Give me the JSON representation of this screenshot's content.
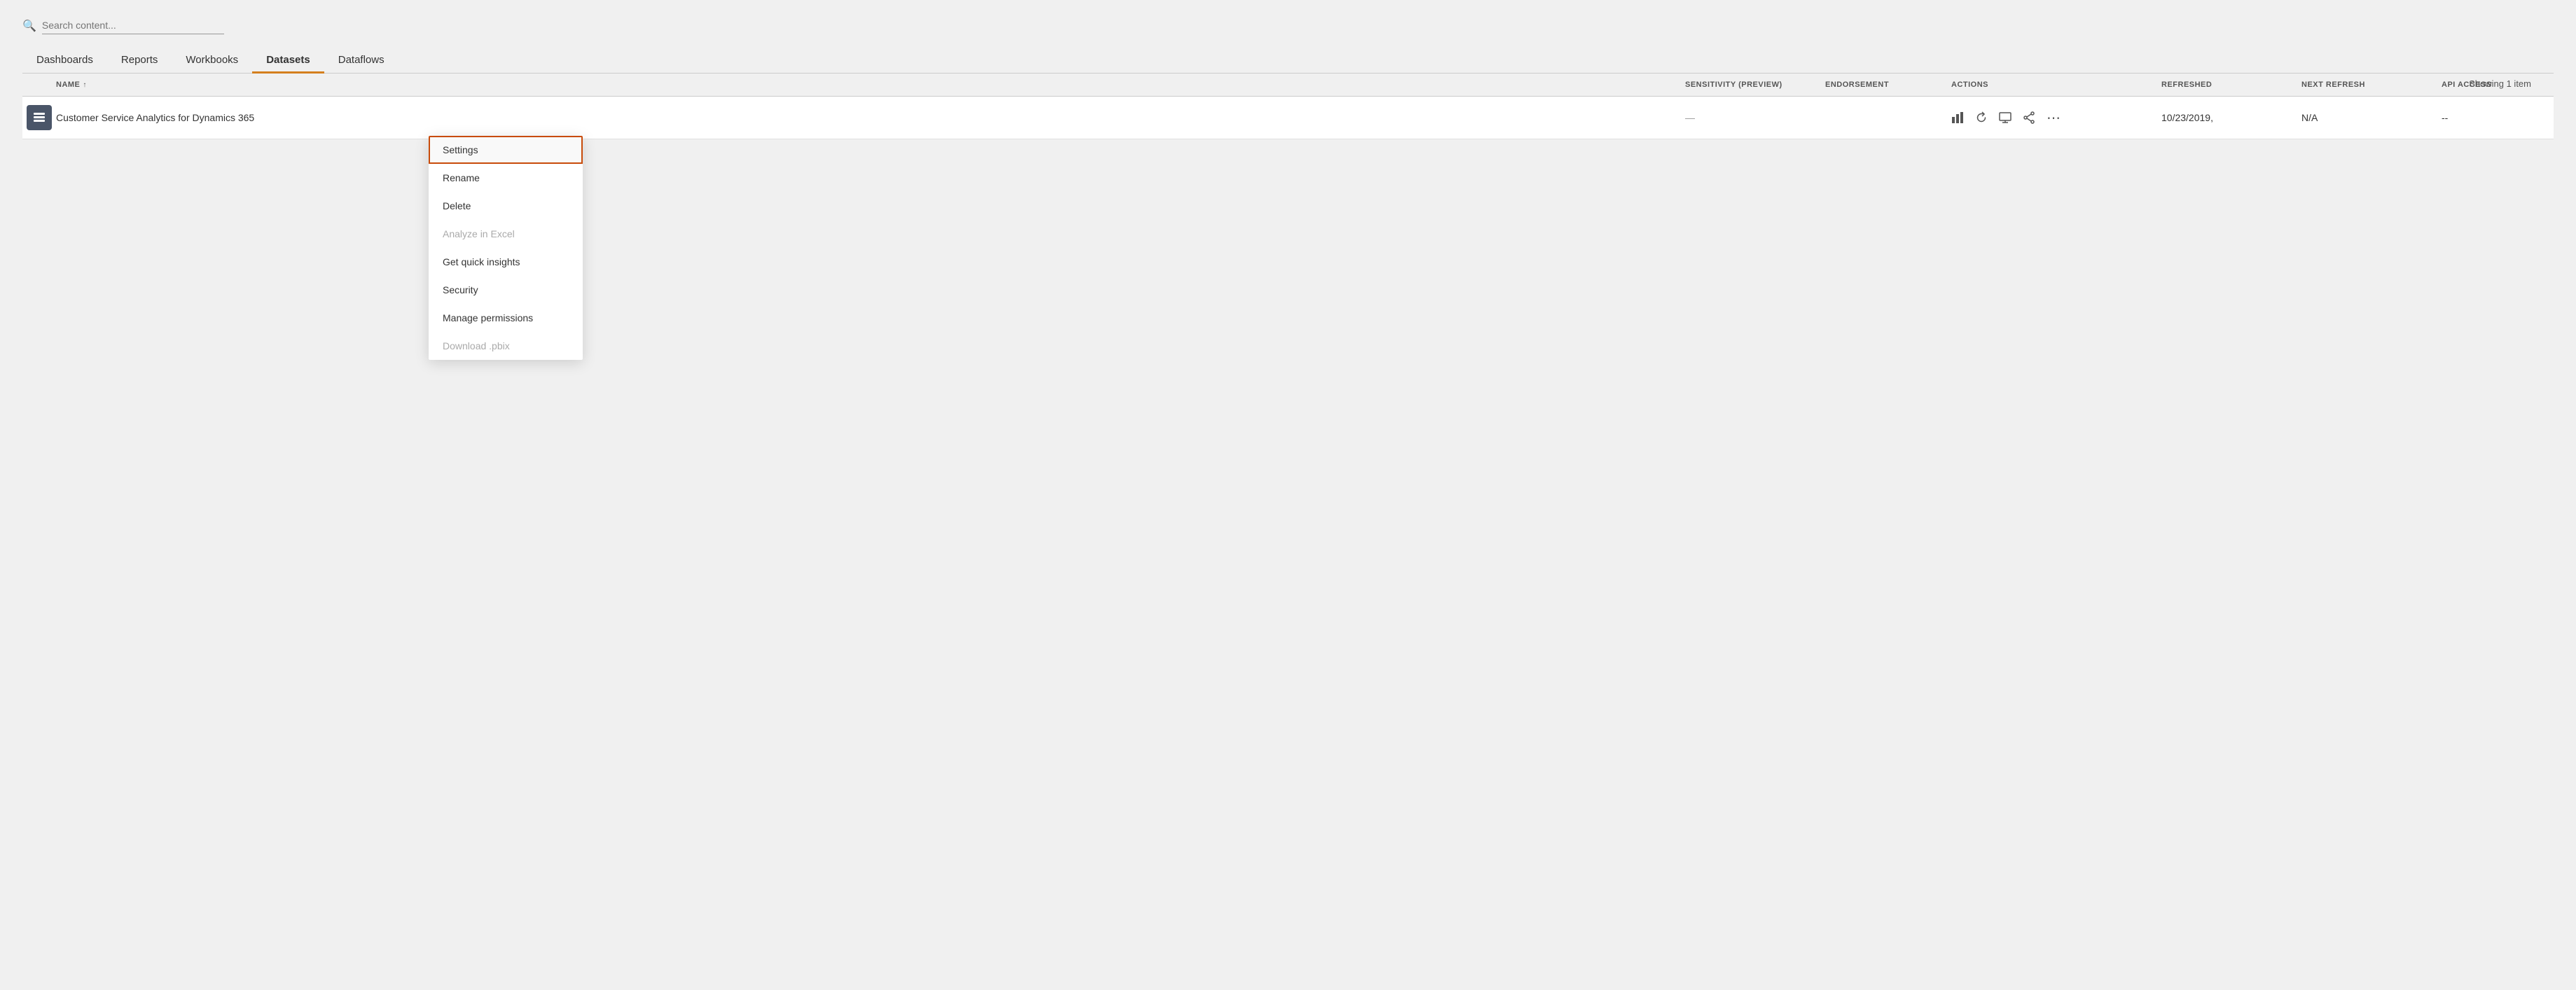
{
  "search": {
    "placeholder": "Search content..."
  },
  "showing": "Showing 1 item",
  "tabs": [
    {
      "id": "dashboards",
      "label": "Dashboards",
      "active": false
    },
    {
      "id": "reports",
      "label": "Reports",
      "active": false
    },
    {
      "id": "workbooks",
      "label": "Workbooks",
      "active": false
    },
    {
      "id": "datasets",
      "label": "Datasets",
      "active": true
    },
    {
      "id": "dataflows",
      "label": "Dataflows",
      "active": false
    }
  ],
  "table": {
    "headers": [
      {
        "id": "icon",
        "label": ""
      },
      {
        "id": "name",
        "label": "NAME",
        "sortable": true,
        "sort": "asc"
      },
      {
        "id": "sensitivity",
        "label": "SENSITIVITY (preview)"
      },
      {
        "id": "endorsement",
        "label": "ENDORSEMENT"
      },
      {
        "id": "actions",
        "label": "ACTIONS"
      },
      {
        "id": "refreshed",
        "label": "REFRESHED"
      },
      {
        "id": "next_refresh",
        "label": "NEXT REFRESH"
      },
      {
        "id": "api_access",
        "label": "API ACCESS"
      }
    ],
    "rows": [
      {
        "name": "Customer Service Analytics for Dynamics 365",
        "sensitivity": "—",
        "endorsement": "",
        "actions": [
          "chart",
          "refresh",
          "compute",
          "share",
          "more"
        ],
        "refreshed": "10/23/2019,",
        "next_refresh": "N/A",
        "api_access": "--"
      }
    ]
  },
  "dropdown": {
    "items": [
      {
        "id": "settings",
        "label": "Settings",
        "highlighted": true,
        "disabled": false
      },
      {
        "id": "rename",
        "label": "Rename",
        "highlighted": false,
        "disabled": false
      },
      {
        "id": "delete",
        "label": "Delete",
        "highlighted": false,
        "disabled": false
      },
      {
        "id": "analyze",
        "label": "Analyze in Excel",
        "highlighted": false,
        "disabled": true
      },
      {
        "id": "insights",
        "label": "Get quick insights",
        "highlighted": false,
        "disabled": false
      },
      {
        "id": "security",
        "label": "Security",
        "highlighted": false,
        "disabled": false
      },
      {
        "id": "permissions",
        "label": "Manage permissions",
        "highlighted": false,
        "disabled": false
      },
      {
        "id": "download",
        "label": "Download .pbix",
        "highlighted": false,
        "disabled": true
      }
    ]
  }
}
